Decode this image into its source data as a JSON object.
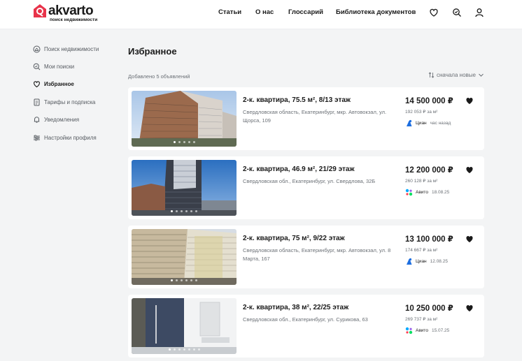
{
  "header": {
    "logo_text": "akvarto",
    "logo_tagline": "поиск недвижимости",
    "nav": [
      "Статьи",
      "О нас",
      "Глоссарий",
      "Библиотека документов"
    ],
    "icons": [
      "heart-icon",
      "saved-search-icon",
      "user-icon"
    ]
  },
  "sidebar": {
    "items": [
      {
        "label": "Поиск недвижимости",
        "icon": "search-home-icon"
      },
      {
        "label": "Мои поиски",
        "icon": "saved-search-icon"
      },
      {
        "label": "Избранное",
        "icon": "heart-icon",
        "active": true
      },
      {
        "label": "Тарифы и подписка",
        "icon": "document-icon"
      },
      {
        "label": "Уведомления",
        "icon": "bell-icon"
      },
      {
        "label": "Настройки профиля",
        "icon": "sliders-icon"
      }
    ]
  },
  "main": {
    "title": "Избранное",
    "count": "Добавлено 5 объявлений",
    "sort_label": "сначала новые"
  },
  "listings": [
    {
      "title": "2-к. квартира, 75.5 м², 8/13 этаж",
      "address": "Свердловская область, Екатеринбург, мкр. Автовокзал, ул. Щорса, 109",
      "price": "14 500 000 ₽",
      "price_per_m": "192 053 ₽ за м²",
      "source": "Циан",
      "date": "час назад",
      "source_icon": "cian-icon"
    },
    {
      "title": "2-к. квартира, 46.9 м², 21/29 этаж",
      "address": "Свердловская обл., Екатеринбург, ул. Свердлова, 32Б",
      "price": "12 200 000 ₽",
      "price_per_m": "260 128 ₽ за м²",
      "source": "Авито",
      "date": "18.08.25",
      "source_icon": "avito-icon"
    },
    {
      "title": "2-к. квартира, 75 м², 9/22 этаж",
      "address": "Свердловская область, Екатеринбург, мкр. Автовокзал, ул. 8 Марта, 167",
      "price": "13 100 000 ₽",
      "price_per_m": "174 667 ₽ за м²",
      "source": "Циан",
      "date": "12.08.25",
      "source_icon": "cian-icon"
    },
    {
      "title": "2-к. квартира, 38 м², 22/25 этаж",
      "address": "Свердловская обл., Екатеринбург, ул. Сурикова, 63",
      "price": "10 250 000 ₽",
      "price_per_m": "269 737 ₽ за м²",
      "source": "Авито",
      "date": "15.07.25",
      "source_icon": "avito-icon"
    }
  ],
  "colors": {
    "brand": "#e8334a",
    "text": "#1a1a1a",
    "muted": "#6b7076",
    "cian": "#1d6ee0"
  }
}
